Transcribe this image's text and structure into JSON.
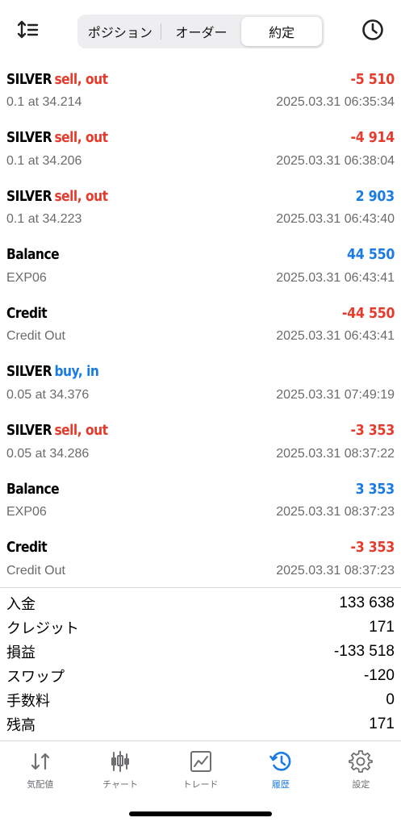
{
  "header": {
    "tabs": [
      {
        "label": "ポジション",
        "active": false
      },
      {
        "label": "オーダー",
        "active": false
      },
      {
        "label": "約定",
        "active": true
      }
    ],
    "left_icon": "sort-icon",
    "right_icon": "clock-icon"
  },
  "deals": [
    {
      "symbol": "SILVER",
      "action": "sell, out",
      "action_color": "red",
      "amount": "-5 510",
      "amount_color": "red",
      "detail": "0.1 at 34.214",
      "time": "2025.03.31 06:35:34"
    },
    {
      "symbol": "SILVER",
      "action": "sell, out",
      "action_color": "red",
      "amount": "-4 914",
      "amount_color": "red",
      "detail": "0.1 at 34.206",
      "time": "2025.03.31 06:38:04"
    },
    {
      "symbol": "SILVER",
      "action": "sell, out",
      "action_color": "red",
      "amount": "2 903",
      "amount_color": "blue",
      "detail": "0.1 at 34.223",
      "time": "2025.03.31 06:43:40"
    },
    {
      "symbol": "Balance",
      "action": "",
      "action_color": "",
      "amount": "44 550",
      "amount_color": "blue",
      "detail": "EXP06",
      "time": "2025.03.31 06:43:41"
    },
    {
      "symbol": "Credit",
      "action": "",
      "action_color": "",
      "amount": "-44 550",
      "amount_color": "red",
      "detail": "Credit Out",
      "time": "2025.03.31 06:43:41"
    },
    {
      "symbol": "SILVER",
      "action": "buy, in",
      "action_color": "blue",
      "amount": "",
      "amount_color": "",
      "detail": "0.05 at 34.376",
      "time": "2025.03.31 07:49:19"
    },
    {
      "symbol": "SILVER",
      "action": "sell, out",
      "action_color": "red",
      "amount": "-3 353",
      "amount_color": "red",
      "detail": "0.05 at 34.286",
      "time": "2025.03.31 08:37:22"
    },
    {
      "symbol": "Balance",
      "action": "",
      "action_color": "",
      "amount": "3 353",
      "amount_color": "blue",
      "detail": "EXP06",
      "time": "2025.03.31 08:37:23"
    },
    {
      "symbol": "Credit",
      "action": "",
      "action_color": "",
      "amount": "-3 353",
      "amount_color": "red",
      "detail": "Credit Out",
      "time": "2025.03.31 08:37:23"
    }
  ],
  "summary": [
    {
      "label": "入金",
      "value": "133 638"
    },
    {
      "label": "クレジット",
      "value": "171"
    },
    {
      "label": "損益",
      "value": "-133 518"
    },
    {
      "label": "スワップ",
      "value": "-120"
    },
    {
      "label": "手数料",
      "value": "0"
    },
    {
      "label": "残高",
      "value": "171"
    }
  ],
  "tabbar": [
    {
      "label": "気配値",
      "icon": "quotes-arrows-icon",
      "active": false
    },
    {
      "label": "チャート",
      "icon": "candlestick-chart-icon",
      "active": false
    },
    {
      "label": "トレード",
      "icon": "trade-line-chart-icon",
      "active": false
    },
    {
      "label": "履歴",
      "icon": "history-clock-icon",
      "active": true
    },
    {
      "label": "設定",
      "icon": "gear-icon",
      "active": false
    }
  ],
  "colors": {
    "red": "#e53b2c",
    "blue": "#1a7be4",
    "gray_text": "#6b6b6b",
    "inactive_tab": "#6e6e73"
  }
}
